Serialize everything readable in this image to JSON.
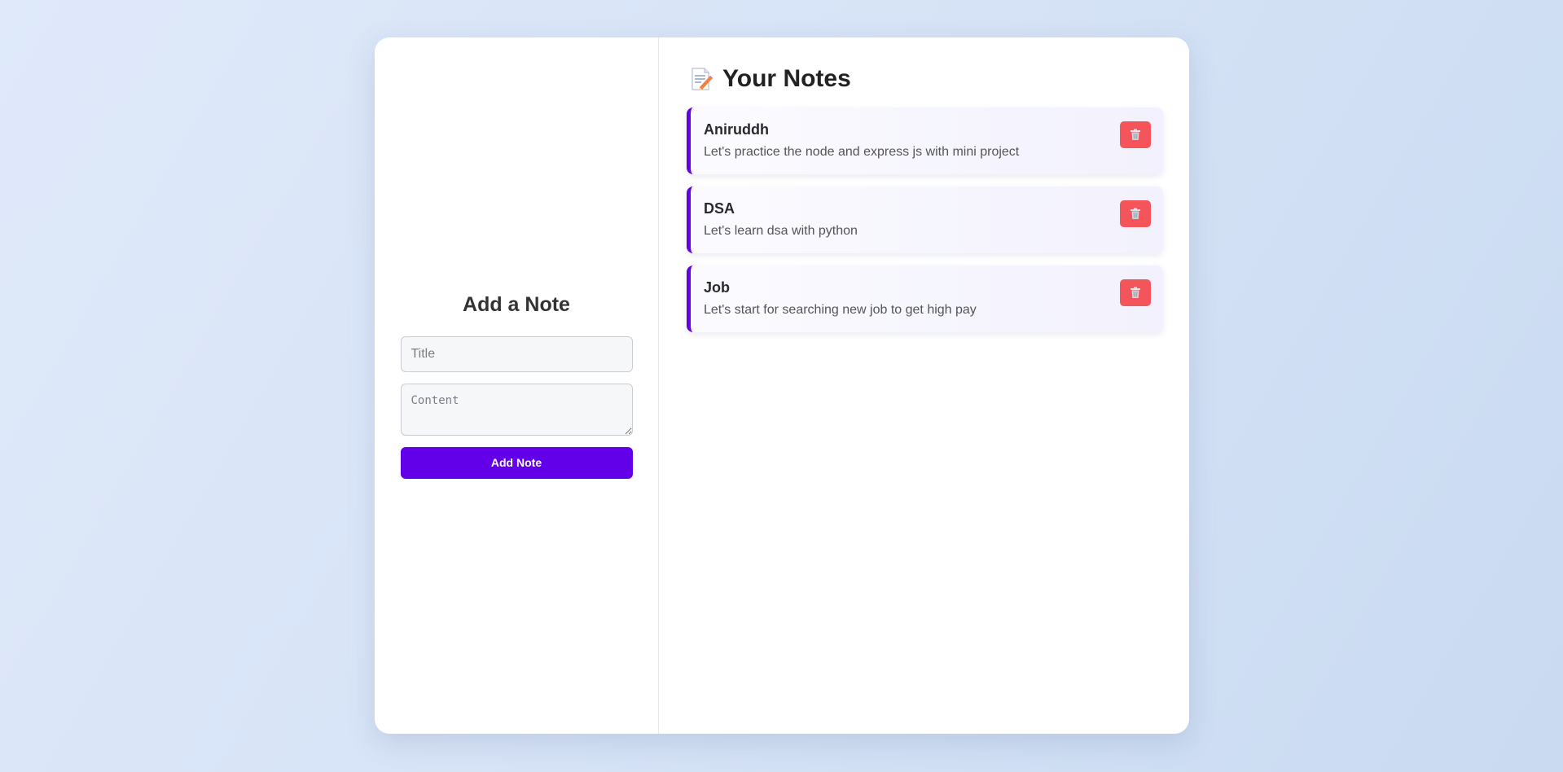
{
  "form": {
    "heading": "Add a Note",
    "title_placeholder": "Title",
    "content_placeholder": "Content",
    "submit_label": "Add Note"
  },
  "notes_panel": {
    "heading": "Your Notes",
    "heading_icon": "memo-icon",
    "notes": [
      {
        "title": "Aniruddh",
        "content": "Let's practice the node and express js with mini project",
        "delete_icon": "trash-icon"
      },
      {
        "title": "DSA",
        "content": "Let's learn dsa with python",
        "delete_icon": "trash-icon"
      },
      {
        "title": "Job",
        "content": "Let's start for searching new job to get high pay",
        "delete_icon": "trash-icon"
      }
    ]
  },
  "colors": {
    "accent": "#6200ea",
    "delete": "#f4555a",
    "background": "#d6e3f6"
  }
}
